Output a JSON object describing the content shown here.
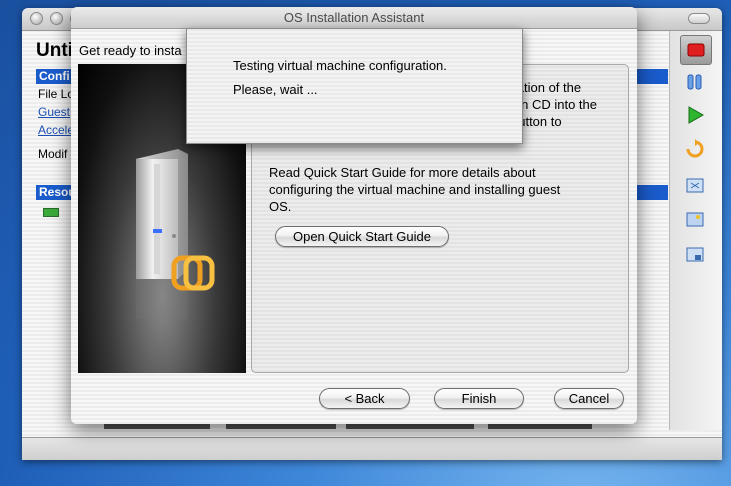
{
  "background_window": {
    "title_partial": "Unti",
    "sections": [
      {
        "label": "Confi"
      },
      {
        "label": "Resou"
      }
    ],
    "lines": [
      "File Lo",
      "Guest",
      "Accele",
      "Modif"
    ]
  },
  "dialog": {
    "title": "OS Installation Assistant",
    "subtitle": "Get ready to insta",
    "info_lines_top": [
      "llation of the",
      "ion CD into the",
      "button to"
    ],
    "info_paragraph_lines": [
      "Read Quick Start Guide for more details about",
      "configuring the virtual machine and installing guest",
      "OS."
    ],
    "quick_start_button": "Open Quick Start Guide",
    "back_button": "< Back",
    "finish_button": "Finish",
    "cancel_button": "Cancel"
  },
  "sheet": {
    "message": "Testing virtual machine configuration.",
    "wait": "Please, wait ..."
  },
  "colors": {
    "section_bar": "#1a5ccc",
    "link": "#1a4fb3",
    "accent_orange": "#f0a020"
  }
}
